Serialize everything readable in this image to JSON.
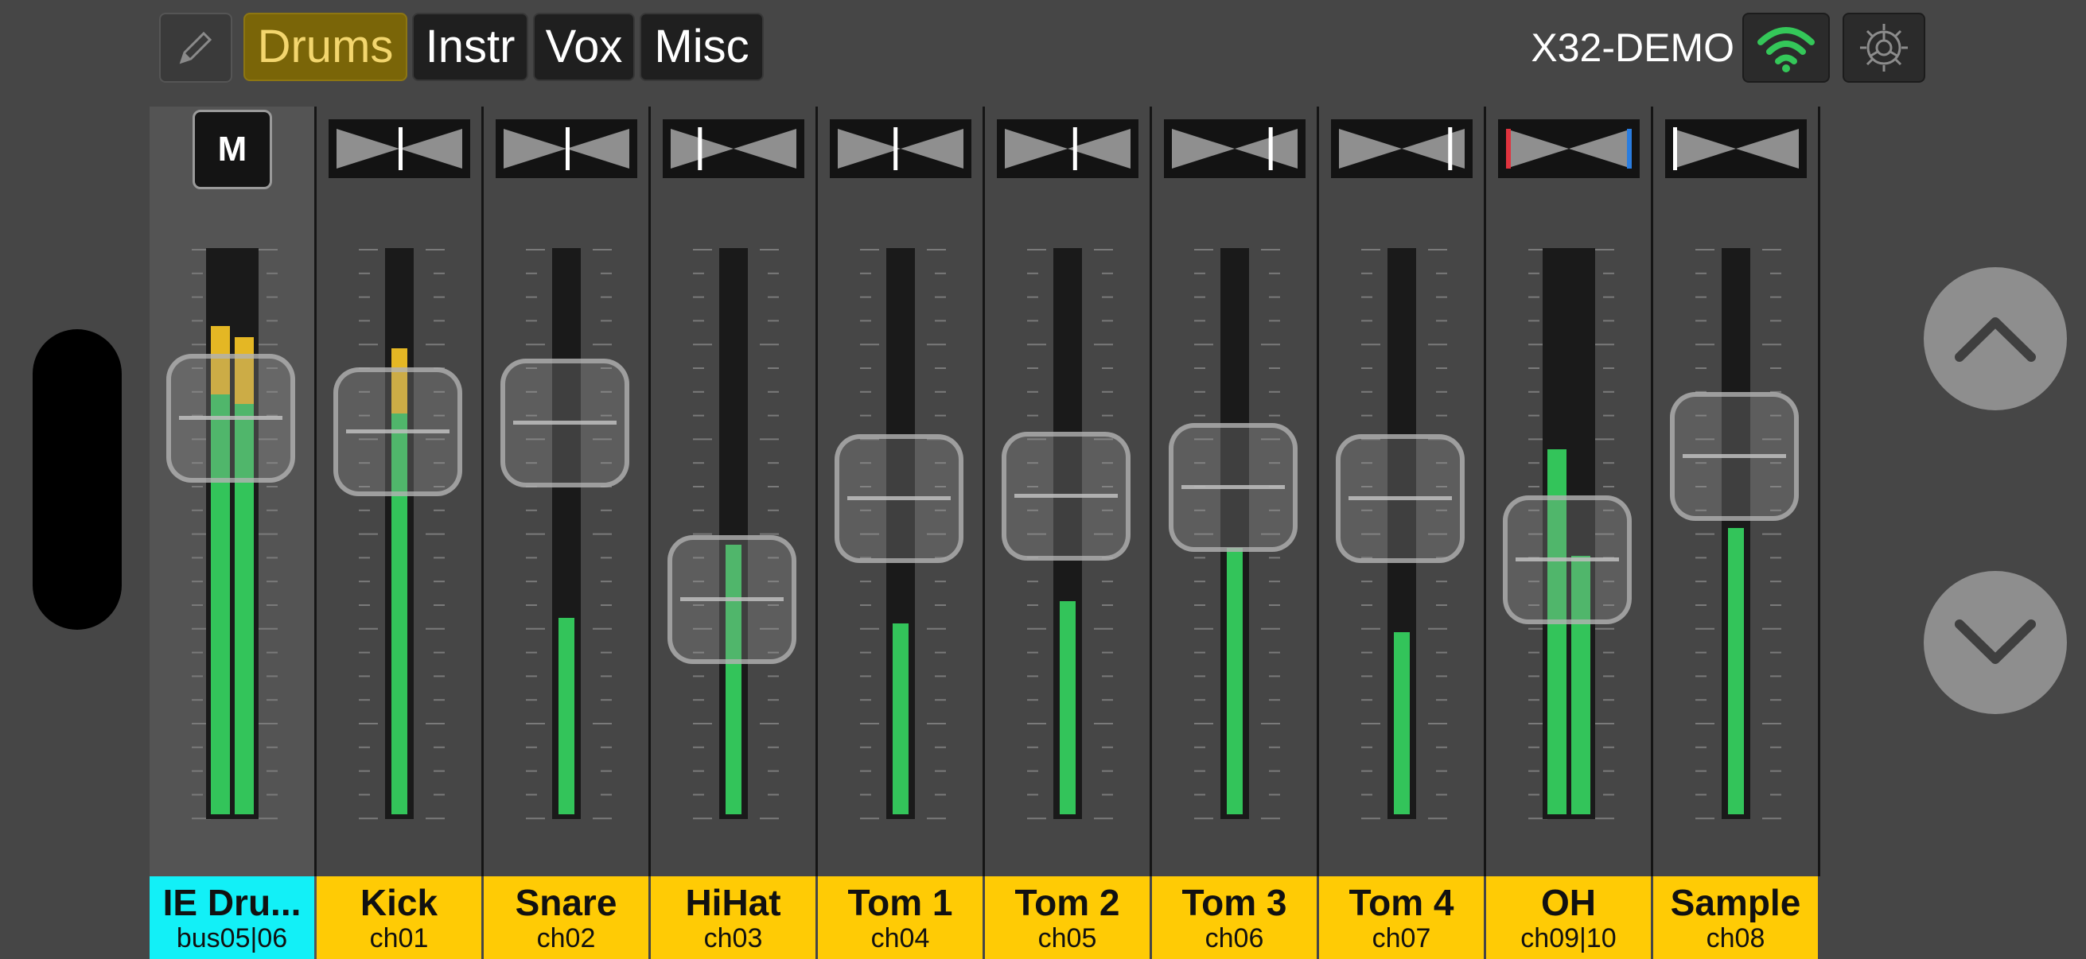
{
  "toolbar": {
    "tabs": [
      {
        "label": "Drums",
        "active": true
      },
      {
        "label": "Instr",
        "active": false
      },
      {
        "label": "Vox",
        "active": false
      },
      {
        "label": "Misc",
        "active": false
      }
    ],
    "device_name": "X32-DEMO"
  },
  "colors": {
    "accent": "#ffcb05",
    "bus_label": "#12f0f7",
    "meter": "#33c45a",
    "meter_peak": "#e4b724",
    "wifi": "#34c759"
  },
  "icons": {
    "edit": "pencil-icon",
    "wifi": "wifi-icon",
    "settings": "gear-icon",
    "up": "chevron-up-icon",
    "down": "chevron-down-icon"
  },
  "strips": [
    {
      "name": "IE Dru...",
      "channel": "bus05|06",
      "master": true,
      "mute_label": "M",
      "fader": 0.76,
      "meter_l": 0.87,
      "meter_r": 0.85,
      "peak": true
    },
    {
      "name": "Kick",
      "channel": "ch01",
      "pan": 0.5,
      "fader": 0.73,
      "meter": 0.83,
      "peak": true
    },
    {
      "name": "Snare",
      "channel": "ch02",
      "pan": 0.5,
      "fader": 0.75,
      "meter": 0.35
    },
    {
      "name": "HiHat",
      "channel": "ch03",
      "pan": 0.22,
      "fader": 0.35,
      "meter": 0.48
    },
    {
      "name": "Tom 1",
      "channel": "ch04",
      "pan": 0.45,
      "fader": 0.58,
      "meter": 0.34
    },
    {
      "name": "Tom 2",
      "channel": "ch05",
      "pan": 0.55,
      "fader": 0.585,
      "meter": 0.38
    },
    {
      "name": "Tom 3",
      "channel": "ch06",
      "pan": 0.78,
      "fader": 0.605,
      "meter": 0.475
    },
    {
      "name": "Tom 4",
      "channel": "ch07",
      "pan": 0.88,
      "fader": 0.58,
      "meter": 0.325
    },
    {
      "name": "OH",
      "channel": "ch09|10",
      "stereo": true,
      "fader": 0.44,
      "meter_l": 0.65,
      "meter_r": 0.46
    },
    {
      "name": "Sample",
      "channel": "ch08",
      "pan": 0.0,
      "fader": 0.675,
      "meter": 0.51
    }
  ]
}
